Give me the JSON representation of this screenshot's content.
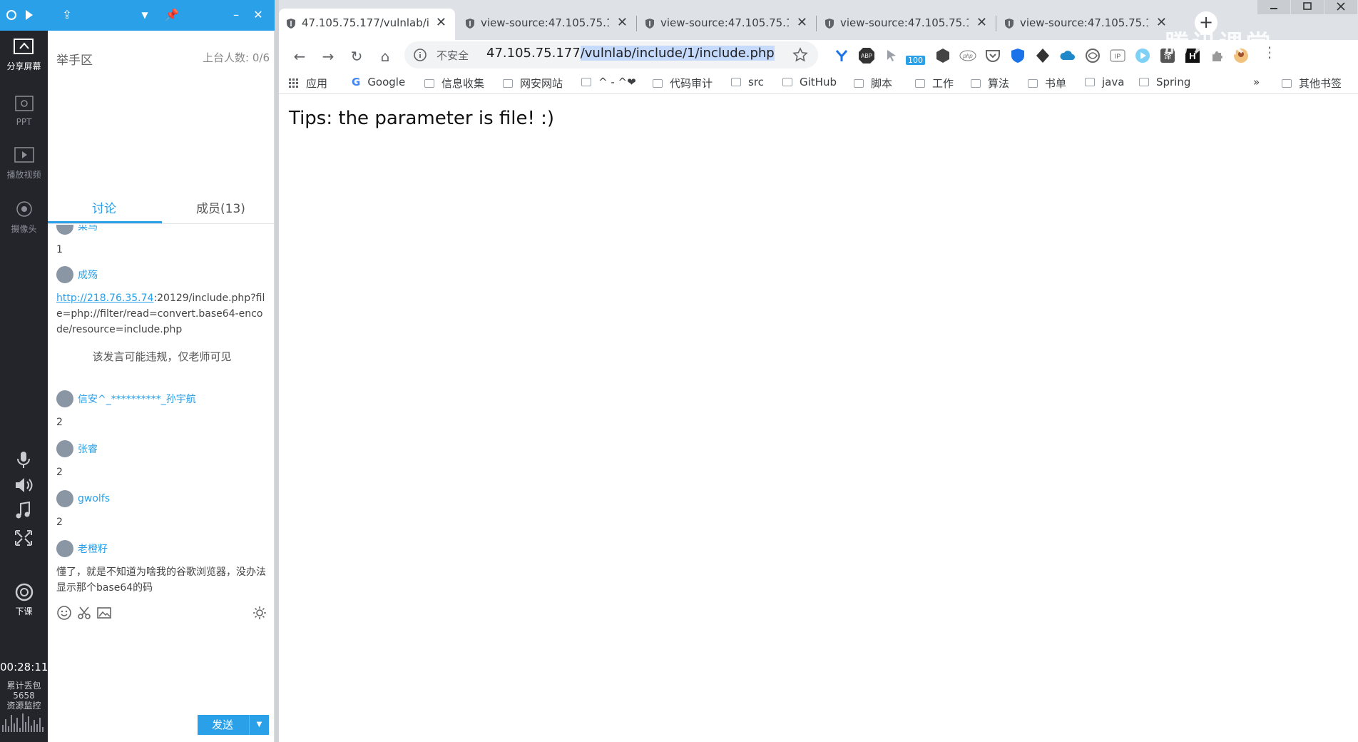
{
  "classroom": {
    "rail": {
      "tools": [
        {
          "label": "分享屏幕"
        },
        {
          "label": "PPT"
        },
        {
          "label": "播放视频"
        },
        {
          "label": "摄像头"
        }
      ],
      "end_class_label": "下课",
      "timer": "00:28:11",
      "packet_loss_label": "累计丢包",
      "packet_loss_value": "5658",
      "resource_monitor_label": "资源监控"
    },
    "panel": {
      "section_title": "举手区",
      "seat_count": "上台人数: 0/6",
      "tabs": [
        {
          "label": "讨论"
        },
        {
          "label": "成员(13)"
        }
      ],
      "messages": [
        {
          "name": "菜鸟",
          "text": "1"
        },
        {
          "name": "成殇",
          "link": "http://218.76.35.74",
          "text": ":20129/include.php?file=php://filter/read=convert.base64-encode/resource=include.php",
          "notice": "该发言可能违规，仅老师可见"
        },
        {
          "name": "信安^_**********_孙宇航",
          "text": "2"
        },
        {
          "name": "张睿",
          "text": "2"
        },
        {
          "name": "gwolfs",
          "text": "2"
        },
        {
          "name": "老橙籽",
          "text": "懂了，就是不知道为啥我的谷歌浏览器，没办法显示那个base64的码"
        }
      ],
      "send_label": "发送"
    }
  },
  "browser": {
    "tabs": [
      {
        "title": "47.105.75.177/vulnlab/i",
        "active": true
      },
      {
        "title": "view-source:47.105.75.1",
        "active": false
      },
      {
        "title": "view-source:47.105.75.1",
        "active": false
      },
      {
        "title": "view-source:47.105.75.1",
        "active": false
      },
      {
        "title": "view-source:47.105.75.1",
        "active": false
      }
    ],
    "omnibox": {
      "security_label": "不安全",
      "host": "47.105.75.177",
      "path": "/vulnlab/include/1/include.php"
    },
    "extension_badge": "100",
    "bookmarks": [
      {
        "label": "应用"
      },
      {
        "label": "Google"
      },
      {
        "label": "信息收集"
      },
      {
        "label": "网安网站"
      },
      {
        "label": "^ - ^❤"
      },
      {
        "label": "代码审计"
      },
      {
        "label": "src"
      },
      {
        "label": "GitHub"
      },
      {
        "label": "脚本"
      },
      {
        "label": "工作"
      },
      {
        "label": "算法"
      },
      {
        "label": "书单"
      },
      {
        "label": "java"
      },
      {
        "label": "Spring"
      }
    ],
    "bookmarks_overflow": "»",
    "other_bookmarks": "其他书签",
    "page_text": "Tips: the parameter is file! :)"
  },
  "watermark": "腾讯课堂",
  "colors": {
    "accent": "#2aa0e8",
    "rail": "#23252b",
    "tabstrip": "#dee1e6"
  }
}
